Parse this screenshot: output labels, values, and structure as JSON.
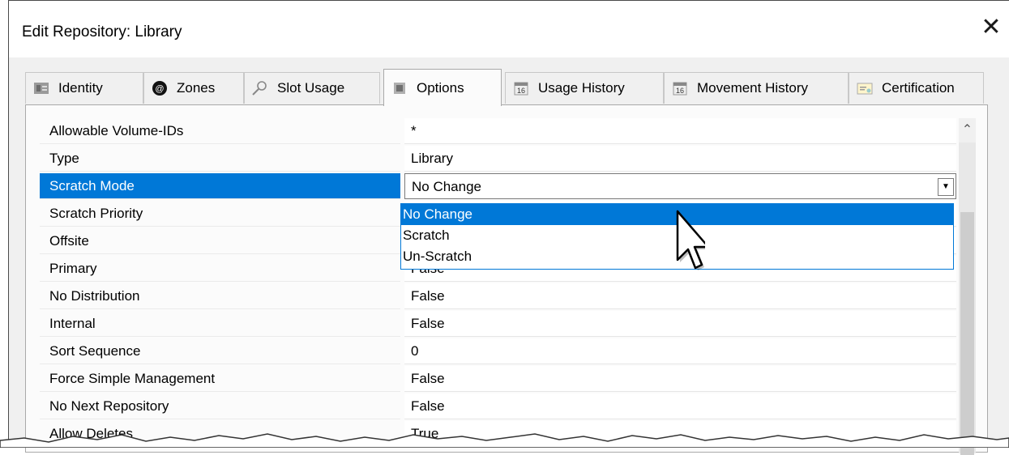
{
  "dialog": {
    "title": "Edit Repository: Library",
    "close_glyph": "✕"
  },
  "tabs": [
    {
      "label": "Identity",
      "icon": "identity-icon"
    },
    {
      "label": "Zones",
      "icon": "zones-icon"
    },
    {
      "label": "Slot Usage",
      "icon": "search-icon"
    },
    {
      "label": "Options",
      "icon": "options-icon",
      "active": true
    },
    {
      "label": "Usage History",
      "icon": "calendar-icon"
    },
    {
      "label": "Movement History",
      "icon": "calendar-icon"
    },
    {
      "label": "Certification",
      "icon": "certificate-icon"
    }
  ],
  "properties": [
    {
      "name": "Allowable Volume-IDs",
      "value": "*"
    },
    {
      "name": "Type",
      "value": "Library"
    },
    {
      "name": "Scratch Mode",
      "value": "No Change",
      "selected": true
    },
    {
      "name": "Scratch Priority",
      "value": ""
    },
    {
      "name": "Offsite",
      "value": ""
    },
    {
      "name": "Primary",
      "value": "False"
    },
    {
      "name": "No Distribution",
      "value": "False"
    },
    {
      "name": "Internal",
      "value": "False"
    },
    {
      "name": "Sort Sequence",
      "value": "0"
    },
    {
      "name": "Force Simple Management",
      "value": "False"
    },
    {
      "name": "No Next Repository",
      "value": "False"
    },
    {
      "name": "Allow Deletes",
      "value": "True"
    }
  ],
  "dropdown": {
    "options": [
      "No Change",
      "Scratch",
      "Un-Scratch"
    ],
    "highlighted": "No Change"
  },
  "colors": {
    "selection": "#0078d7",
    "dialog_bg": "#f0f0f0"
  }
}
